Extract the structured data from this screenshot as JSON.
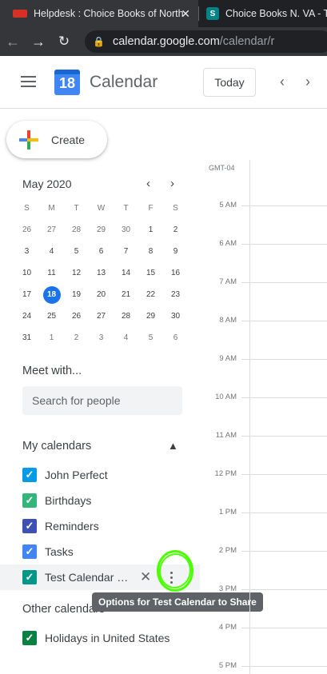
{
  "browser": {
    "tabs": [
      {
        "title": "Helpdesk : Choice Books of North",
        "close": "✕"
      },
      {
        "title": "Choice Books N. VA - Te",
        "icon_letter": "S"
      }
    ],
    "url_main": "calendar.google.com",
    "url_path": "/calendar/r"
  },
  "header": {
    "logo_day": "18",
    "title": "Calendar",
    "today_label": "Today",
    "prev_icon": "‹",
    "next_icon": "›"
  },
  "create": {
    "label": "Create"
  },
  "mini_calendar": {
    "title": "May 2020",
    "weekdays": [
      "S",
      "M",
      "T",
      "W",
      "T",
      "F",
      "S"
    ],
    "weeks": [
      [
        "26",
        "27",
        "28",
        "29",
        "30",
        "1",
        "2"
      ],
      [
        "3",
        "4",
        "5",
        "6",
        "7",
        "8",
        "9"
      ],
      [
        "10",
        "11",
        "12",
        "13",
        "14",
        "15",
        "16"
      ],
      [
        "17",
        "18",
        "19",
        "20",
        "21",
        "22",
        "23"
      ],
      [
        "24",
        "25",
        "26",
        "27",
        "28",
        "29",
        "30"
      ],
      [
        "31",
        "1",
        "2",
        "3",
        "4",
        "5",
        "6"
      ]
    ],
    "today": "18"
  },
  "meet_with": {
    "title": "Meet with...",
    "placeholder": "Search for people"
  },
  "my_calendars": {
    "title": "My calendars",
    "items": [
      {
        "label": "John Perfect",
        "color": "#039be5"
      },
      {
        "label": "Birthdays",
        "color": "#33b679"
      },
      {
        "label": "Reminders",
        "color": "#3f51b5"
      },
      {
        "label": "Tasks",
        "color": "#4285f4"
      },
      {
        "label": "Test Calendar to Share",
        "color": "#009688"
      }
    ]
  },
  "other_calendars": {
    "title": "Other calendars",
    "items": [
      {
        "label": "Holidays in United States",
        "color": "#0b8043"
      }
    ]
  },
  "tooltip": "Options for Test Calendar to Share",
  "day_view": {
    "timezone": "GMT-04",
    "hours": [
      "5 AM",
      "6 AM",
      "7 AM",
      "8 AM",
      "9 AM",
      "10 AM",
      "11 AM",
      "12 PM",
      "1 PM",
      "2 PM",
      "3 PM",
      "4 PM",
      "5 PM"
    ]
  }
}
